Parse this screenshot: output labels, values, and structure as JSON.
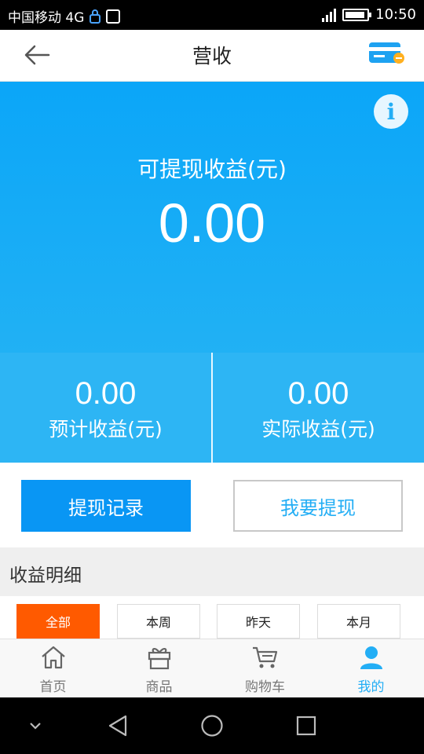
{
  "status_bar": {
    "carrier": "中国移动 4G",
    "network": "4G",
    "time": "10:50"
  },
  "header": {
    "title": "营收",
    "back_icon": "arrow-left-icon",
    "card_icon": "credit-card-icon"
  },
  "hero": {
    "info_glyph": "i",
    "label": "可提现收益(元)",
    "amount": "0.00"
  },
  "stats": [
    {
      "value": "0.00",
      "label": "预计收益(元)"
    },
    {
      "value": "0.00",
      "label": "实际收益(元)"
    }
  ],
  "buttons": {
    "records": "提现记录",
    "withdraw": "我要提现"
  },
  "details": {
    "title": "收益明细",
    "filters": [
      "全部",
      "本周",
      "昨天",
      "本月"
    ],
    "active_filter": "全部"
  },
  "tabbar": [
    {
      "label": "首页",
      "icon": "home-icon"
    },
    {
      "label": "商品",
      "icon": "gift-icon"
    },
    {
      "label": "购物车",
      "icon": "cart-icon"
    },
    {
      "label": "我的",
      "icon": "user-icon",
      "active": true
    }
  ],
  "colors": {
    "primary_blue": "#0ba6f8",
    "button_blue": "#0996f4",
    "accent_orange": "#ff5a00",
    "active_tab": "#23aef5"
  }
}
